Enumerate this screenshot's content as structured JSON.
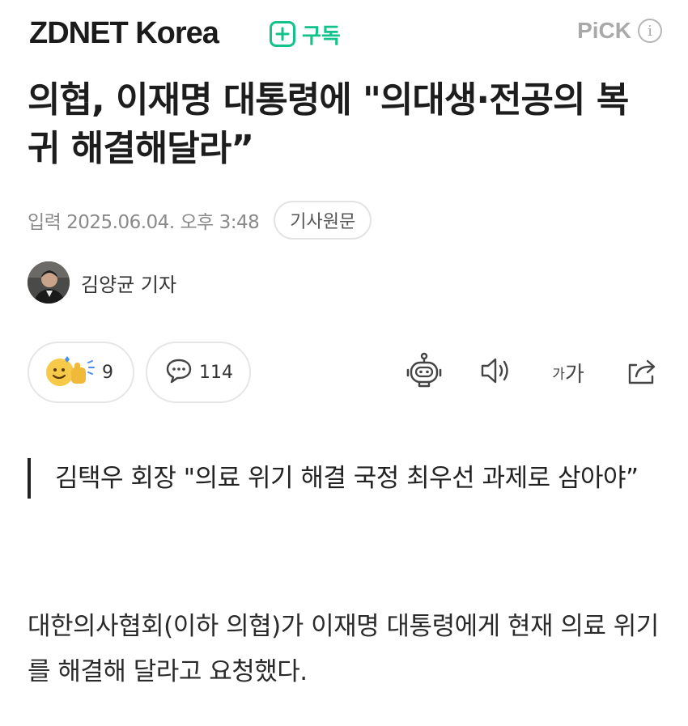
{
  "header": {
    "brand": "ZDNET Korea",
    "subscribe_label": "구독",
    "pick_label": "PiCK",
    "info_glyph": "i"
  },
  "article": {
    "headline": "의협, 이재명 대통령에 \"의대생·전공의 복귀 해결해달라”",
    "date": "입력 2025.06.04. 오후 3:48",
    "source_button": "기사원문",
    "reporter": "김양균 기자",
    "subheading": "김택우 회장 \"의료 위기 해결 국정 최우선 과제로 삼아야”",
    "body": "대한의사협회(이하 의협)가 이재명 대통령에게 현재 의료 위기를 해결해 달라고 요청했다."
  },
  "actions": {
    "reaction_count": "9",
    "comment_count": "114",
    "font_small": "가",
    "font_large": "가"
  },
  "icons": {
    "subscribe": "plus-icon",
    "info": "info-icon",
    "reaction": "smile-thumbs-icon",
    "comment": "speech-bubble-icon",
    "summary": "robot-icon",
    "listen": "speaker-icon",
    "share": "share-icon"
  },
  "colors": {
    "accent": "#13c28a",
    "muted": "#8a8a8a"
  }
}
